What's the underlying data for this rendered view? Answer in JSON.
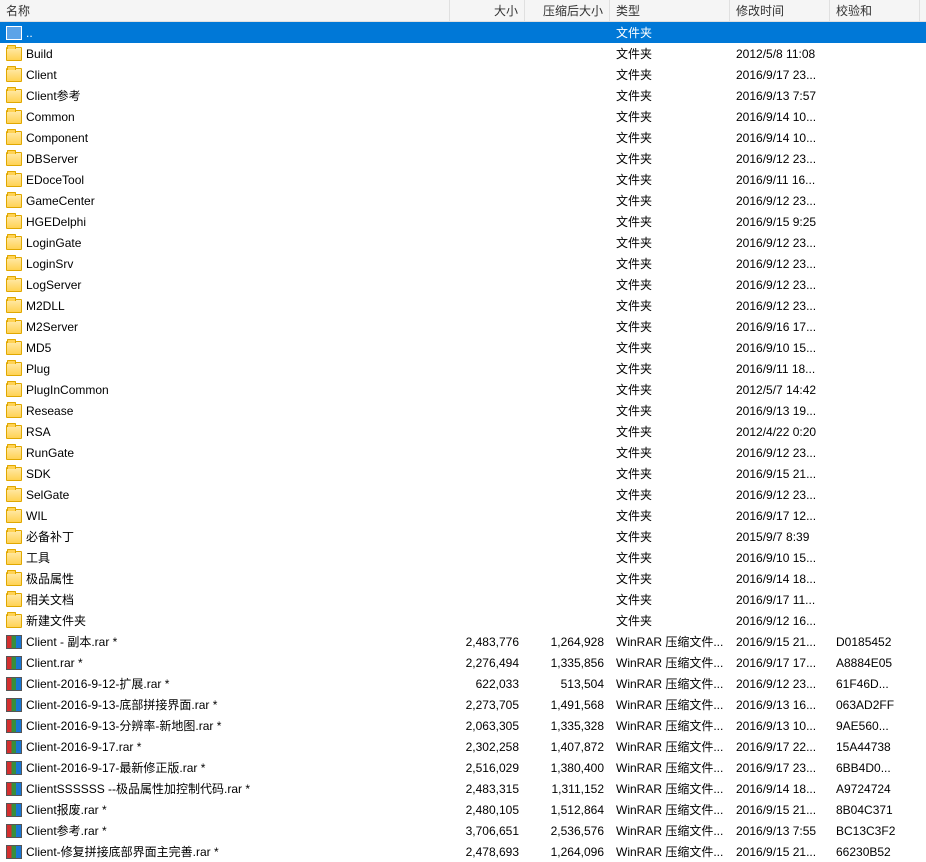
{
  "columns": {
    "name": "名称",
    "size": "大小",
    "compressed": "压缩后大小",
    "type": "类型",
    "modified": "修改时间",
    "checksum": "校验和"
  },
  "rows": [
    {
      "icon": "parent",
      "name": "..",
      "size": "",
      "compressed": "",
      "type": "文件夹",
      "modified": "",
      "checksum": "",
      "selected": true
    },
    {
      "icon": "folder",
      "name": "Build",
      "size": "",
      "compressed": "",
      "type": "文件夹",
      "modified": "2012/5/8 11:08",
      "checksum": ""
    },
    {
      "icon": "folder",
      "name": "Client",
      "size": "",
      "compressed": "",
      "type": "文件夹",
      "modified": "2016/9/17 23...",
      "checksum": ""
    },
    {
      "icon": "folder",
      "name": "Client参考",
      "size": "",
      "compressed": "",
      "type": "文件夹",
      "modified": "2016/9/13 7:57",
      "checksum": ""
    },
    {
      "icon": "folder",
      "name": "Common",
      "size": "",
      "compressed": "",
      "type": "文件夹",
      "modified": "2016/9/14 10...",
      "checksum": ""
    },
    {
      "icon": "folder",
      "name": "Component",
      "size": "",
      "compressed": "",
      "type": "文件夹",
      "modified": "2016/9/14 10...",
      "checksum": ""
    },
    {
      "icon": "folder",
      "name": "DBServer",
      "size": "",
      "compressed": "",
      "type": "文件夹",
      "modified": "2016/9/12 23...",
      "checksum": ""
    },
    {
      "icon": "folder",
      "name": "EDoceTool",
      "size": "",
      "compressed": "",
      "type": "文件夹",
      "modified": "2016/9/11 16...",
      "checksum": ""
    },
    {
      "icon": "folder",
      "name": "GameCenter",
      "size": "",
      "compressed": "",
      "type": "文件夹",
      "modified": "2016/9/12 23...",
      "checksum": ""
    },
    {
      "icon": "folder",
      "name": "HGEDelphi",
      "size": "",
      "compressed": "",
      "type": "文件夹",
      "modified": "2016/9/15 9:25",
      "checksum": ""
    },
    {
      "icon": "folder",
      "name": "LoginGate",
      "size": "",
      "compressed": "",
      "type": "文件夹",
      "modified": "2016/9/12 23...",
      "checksum": ""
    },
    {
      "icon": "folder",
      "name": "LoginSrv",
      "size": "",
      "compressed": "",
      "type": "文件夹",
      "modified": "2016/9/12 23...",
      "checksum": ""
    },
    {
      "icon": "folder",
      "name": "LogServer",
      "size": "",
      "compressed": "",
      "type": "文件夹",
      "modified": "2016/9/12 23...",
      "checksum": ""
    },
    {
      "icon": "folder",
      "name": "M2DLL",
      "size": "",
      "compressed": "",
      "type": "文件夹",
      "modified": "2016/9/12 23...",
      "checksum": ""
    },
    {
      "icon": "folder",
      "name": "M2Server",
      "size": "",
      "compressed": "",
      "type": "文件夹",
      "modified": "2016/9/16 17...",
      "checksum": ""
    },
    {
      "icon": "folder",
      "name": "MD5",
      "size": "",
      "compressed": "",
      "type": "文件夹",
      "modified": "2016/9/10 15...",
      "checksum": ""
    },
    {
      "icon": "folder",
      "name": "Plug",
      "size": "",
      "compressed": "",
      "type": "文件夹",
      "modified": "2016/9/11 18...",
      "checksum": ""
    },
    {
      "icon": "folder",
      "name": "PlugInCommon",
      "size": "",
      "compressed": "",
      "type": "文件夹",
      "modified": "2012/5/7 14:42",
      "checksum": ""
    },
    {
      "icon": "folder",
      "name": "Resease",
      "size": "",
      "compressed": "",
      "type": "文件夹",
      "modified": "2016/9/13 19...",
      "checksum": ""
    },
    {
      "icon": "folder",
      "name": "RSA",
      "size": "",
      "compressed": "",
      "type": "文件夹",
      "modified": "2012/4/22 0:20",
      "checksum": ""
    },
    {
      "icon": "folder",
      "name": "RunGate",
      "size": "",
      "compressed": "",
      "type": "文件夹",
      "modified": "2016/9/12 23...",
      "checksum": ""
    },
    {
      "icon": "folder",
      "name": "SDK",
      "size": "",
      "compressed": "",
      "type": "文件夹",
      "modified": "2016/9/15 21...",
      "checksum": ""
    },
    {
      "icon": "folder",
      "name": "SelGate",
      "size": "",
      "compressed": "",
      "type": "文件夹",
      "modified": "2016/9/12 23...",
      "checksum": ""
    },
    {
      "icon": "folder",
      "name": "WIL",
      "size": "",
      "compressed": "",
      "type": "文件夹",
      "modified": "2016/9/17 12...",
      "checksum": ""
    },
    {
      "icon": "folder",
      "name": "必备补丁",
      "size": "",
      "compressed": "",
      "type": "文件夹",
      "modified": "2015/9/7 8:39",
      "checksum": ""
    },
    {
      "icon": "folder",
      "name": "工具",
      "size": "",
      "compressed": "",
      "type": "文件夹",
      "modified": "2016/9/10 15...",
      "checksum": ""
    },
    {
      "icon": "folder",
      "name": "极品属性",
      "size": "",
      "compressed": "",
      "type": "文件夹",
      "modified": "2016/9/14 18...",
      "checksum": ""
    },
    {
      "icon": "folder",
      "name": "相关文档",
      "size": "",
      "compressed": "",
      "type": "文件夹",
      "modified": "2016/9/17 11...",
      "checksum": ""
    },
    {
      "icon": "folder",
      "name": "新建文件夹",
      "size": "",
      "compressed": "",
      "type": "文件夹",
      "modified": "2016/9/12 16...",
      "checksum": ""
    },
    {
      "icon": "rar",
      "name": "Client - 副本.rar *",
      "size": "2,483,776",
      "compressed": "1,264,928",
      "type": "WinRAR 压缩文件...",
      "modified": "2016/9/15 21...",
      "checksum": "D0185452"
    },
    {
      "icon": "rar",
      "name": "Client.rar *",
      "size": "2,276,494",
      "compressed": "1,335,856",
      "type": "WinRAR 压缩文件...",
      "modified": "2016/9/17 17...",
      "checksum": "A8884E05"
    },
    {
      "icon": "rar",
      "name": "Client-2016-9-12-扩展.rar *",
      "size": "622,033",
      "compressed": "513,504",
      "type": "WinRAR 压缩文件...",
      "modified": "2016/9/12 23...",
      "checksum": "61F46D..."
    },
    {
      "icon": "rar",
      "name": "Client-2016-9-13-底部拼接界面.rar *",
      "size": "2,273,705",
      "compressed": "1,491,568",
      "type": "WinRAR 压缩文件...",
      "modified": "2016/9/13 16...",
      "checksum": "063AD2FF"
    },
    {
      "icon": "rar",
      "name": "Client-2016-9-13-分辨率-新地图.rar *",
      "size": "2,063,305",
      "compressed": "1,335,328",
      "type": "WinRAR 压缩文件...",
      "modified": "2016/9/13 10...",
      "checksum": "9AE560..."
    },
    {
      "icon": "rar",
      "name": "Client-2016-9-17.rar *",
      "size": "2,302,258",
      "compressed": "1,407,872",
      "type": "WinRAR 压缩文件...",
      "modified": "2016/9/17 22...",
      "checksum": "15A44738"
    },
    {
      "icon": "rar",
      "name": "Client-2016-9-17-最新修正版.rar *",
      "size": "2,516,029",
      "compressed": "1,380,400",
      "type": "WinRAR 压缩文件...",
      "modified": "2016/9/17 23...",
      "checksum": "6BB4D0..."
    },
    {
      "icon": "rar",
      "name": "ClientSSSSSS --极品属性加控制代码.rar *",
      "size": "2,483,315",
      "compressed": "1,311,152",
      "type": "WinRAR 压缩文件...",
      "modified": "2016/9/14 18...",
      "checksum": "A9724724"
    },
    {
      "icon": "rar",
      "name": "Client报废.rar *",
      "size": "2,480,105",
      "compressed": "1,512,864",
      "type": "WinRAR 压缩文件...",
      "modified": "2016/9/15 21...",
      "checksum": "8B04C371"
    },
    {
      "icon": "rar",
      "name": "Client参考.rar *",
      "size": "3,706,651",
      "compressed": "2,536,576",
      "type": "WinRAR 压缩文件...",
      "modified": "2016/9/13 7:55",
      "checksum": "BC13C3F2"
    },
    {
      "icon": "rar",
      "name": "Client-修复拼接底部界面主完善.rar *",
      "size": "2,478,693",
      "compressed": "1,264,096",
      "type": "WinRAR 压缩文件...",
      "modified": "2016/9/15 21...",
      "checksum": "66230B52"
    }
  ]
}
